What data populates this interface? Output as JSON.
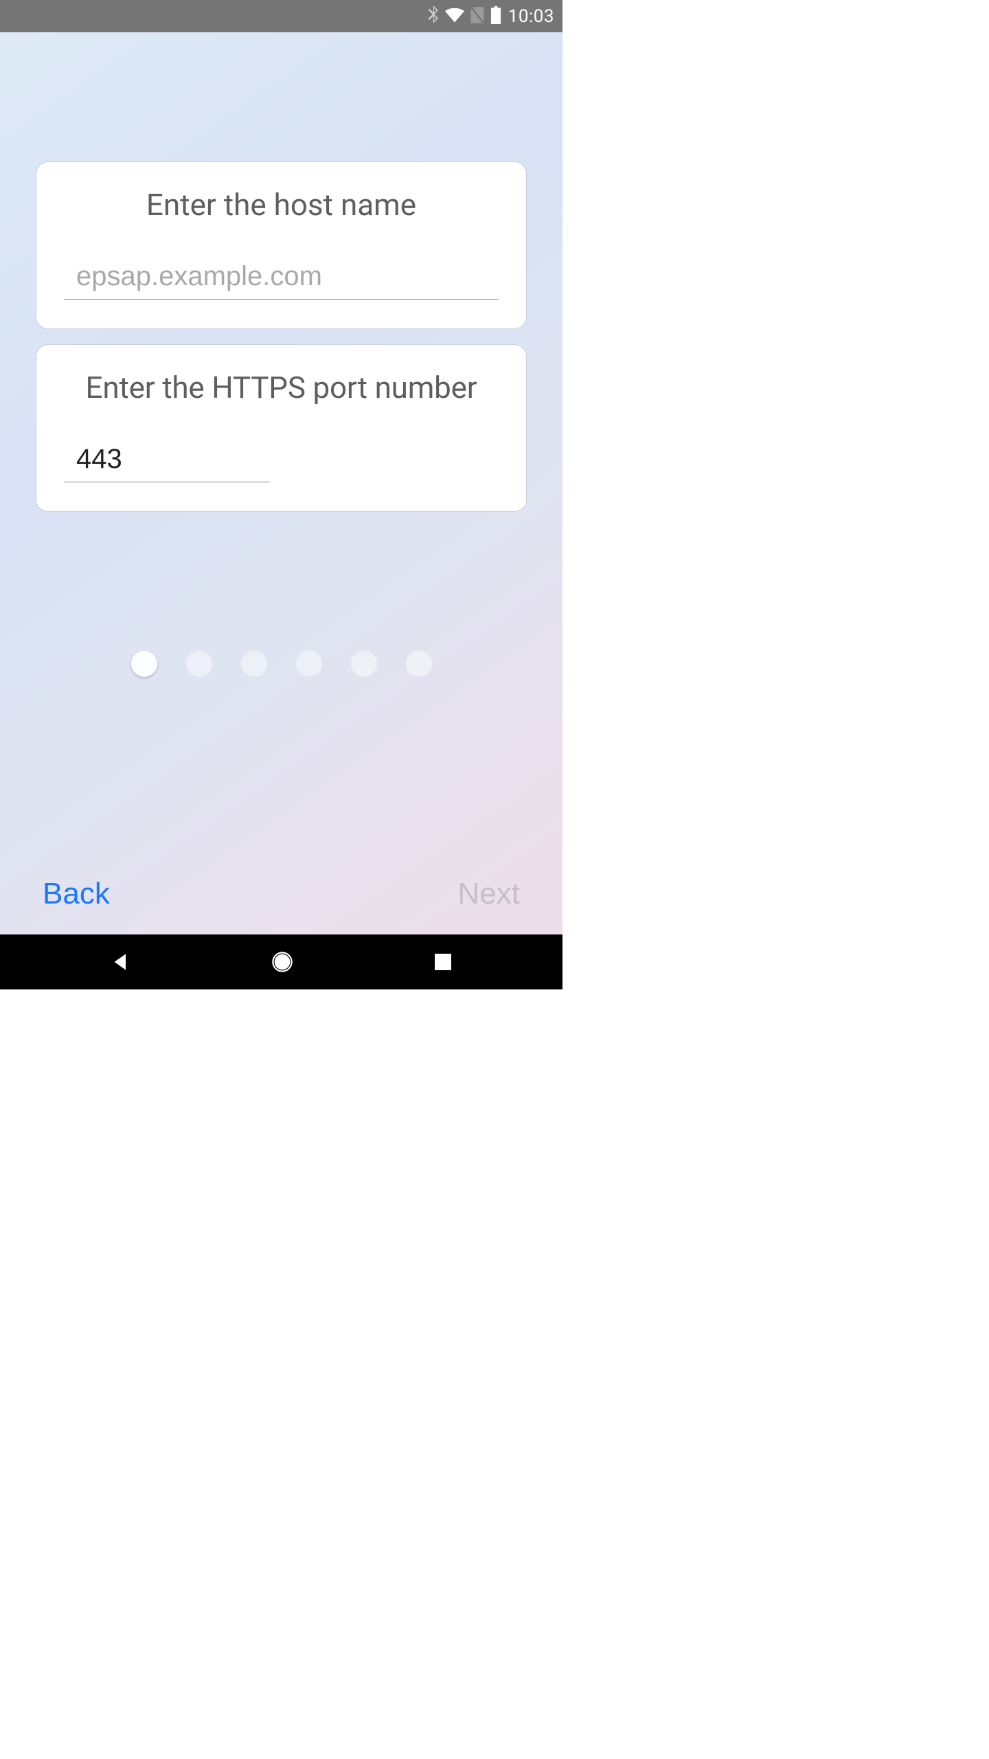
{
  "statusbar": {
    "time": "10:03"
  },
  "cards": {
    "host": {
      "title": "Enter the host name",
      "placeholder": "epsap.example.com",
      "value": ""
    },
    "port": {
      "title": "Enter the HTTPS port number",
      "value": "443"
    }
  },
  "pagination": {
    "total": 6,
    "active": 0
  },
  "nav": {
    "back_label": "Back",
    "next_label": "Next"
  }
}
